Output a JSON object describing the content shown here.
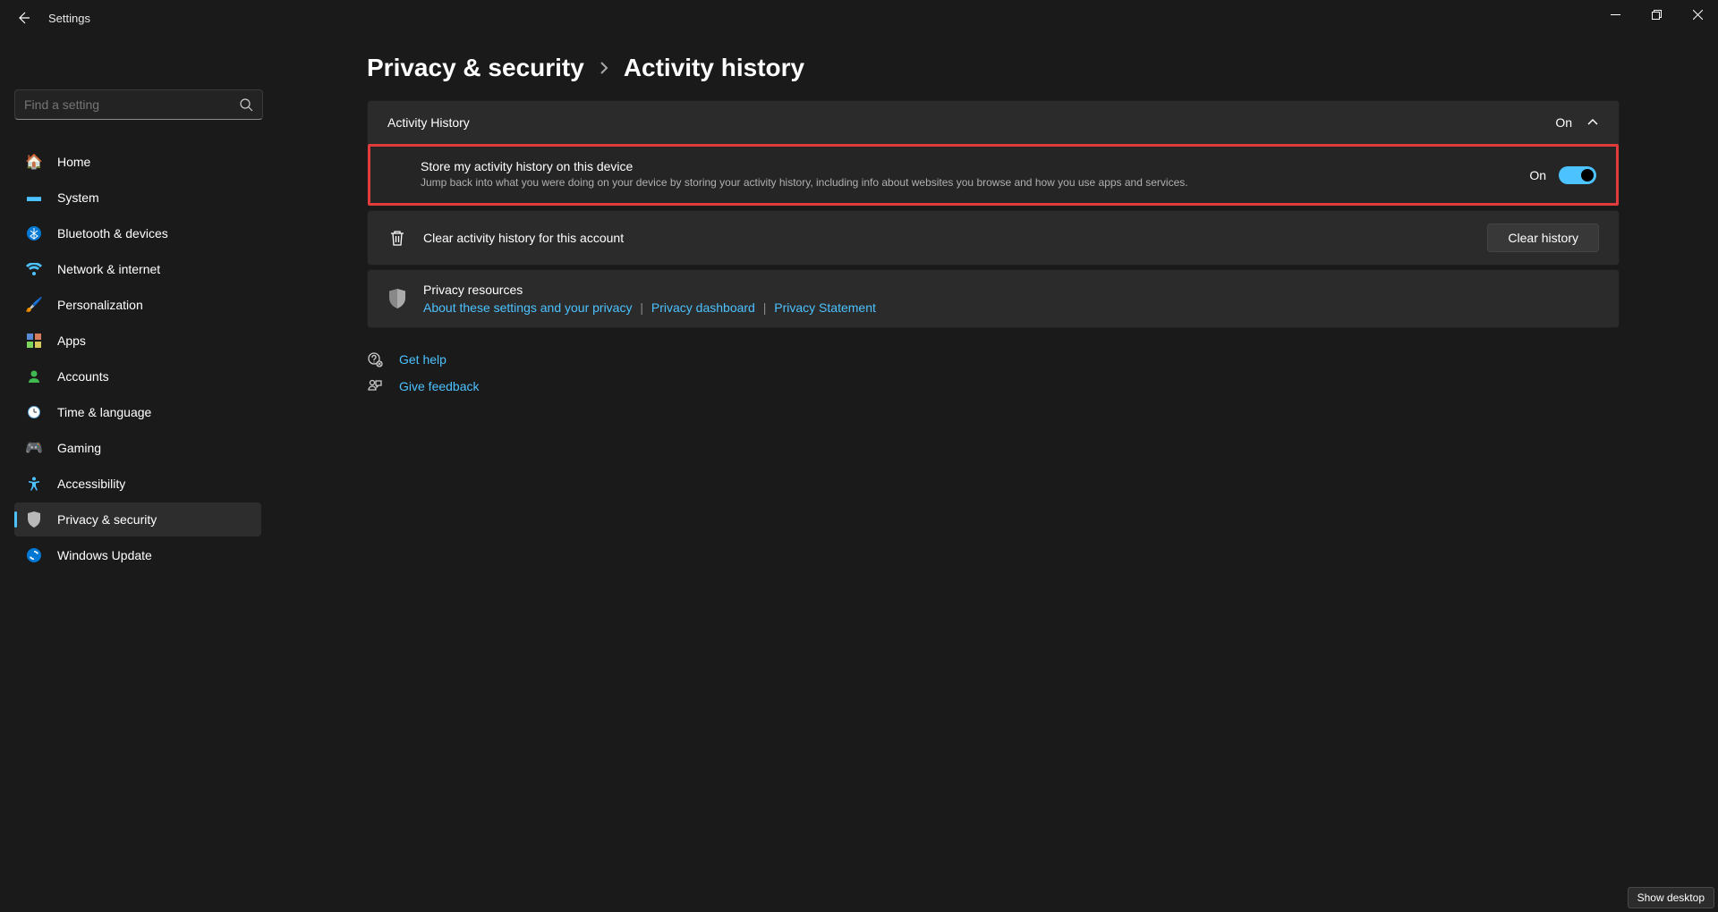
{
  "window": {
    "title": "Settings",
    "desktop_tip": "Show desktop"
  },
  "search": {
    "placeholder": "Find a setting"
  },
  "sidebar": {
    "items": [
      {
        "label": "Home",
        "icon": "🏠",
        "active": false
      },
      {
        "label": "System",
        "icon": "🖥️",
        "active": false
      },
      {
        "label": "Bluetooth & devices",
        "icon": "bt",
        "active": false
      },
      {
        "label": "Network & internet",
        "icon": "wifi",
        "active": false
      },
      {
        "label": "Personalization",
        "icon": "🖌️",
        "active": false
      },
      {
        "label": "Apps",
        "icon": "apps",
        "active": false
      },
      {
        "label": "Accounts",
        "icon": "👤",
        "active": false
      },
      {
        "label": "Time & language",
        "icon": "🕐",
        "active": false
      },
      {
        "label": "Gaming",
        "icon": "🎮",
        "active": false
      },
      {
        "label": "Accessibility",
        "icon": "acc",
        "active": false
      },
      {
        "label": "Privacy & security",
        "icon": "🛡️",
        "active": true
      },
      {
        "label": "Windows Update",
        "icon": "🔄",
        "active": false
      }
    ]
  },
  "breadcrumb": {
    "parent": "Privacy & security",
    "current": "Activity history"
  },
  "activity_card": {
    "title": "Activity History",
    "state": "On"
  },
  "store_row": {
    "title": "Store my activity history on this device",
    "desc": "Jump back into what you were doing on your device by storing your activity history, including info about websites you browse and how you use apps and services.",
    "state": "On"
  },
  "clear_row": {
    "label": "Clear activity history for this account",
    "button": "Clear history"
  },
  "resources": {
    "title": "Privacy resources",
    "link1": "About these settings and your privacy",
    "link2": "Privacy dashboard",
    "link3": "Privacy Statement"
  },
  "support": {
    "help": "Get help",
    "feedback": "Give feedback"
  }
}
